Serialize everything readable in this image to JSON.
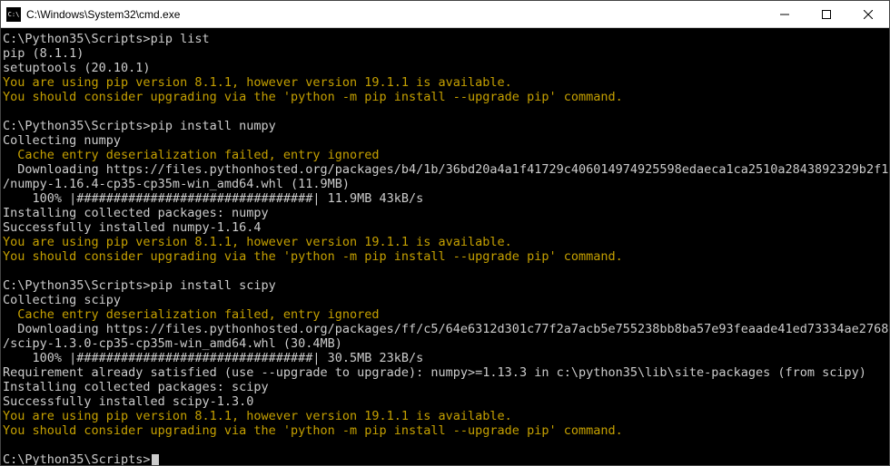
{
  "window": {
    "title": "C:\\Windows\\System32\\cmd.exe"
  },
  "prompt": "C:\\Python35\\Scripts>",
  "cmds": {
    "list": "pip list",
    "install_numpy": "pip install numpy",
    "install_scipy": "pip install scipy"
  },
  "out": {
    "pip_ver": "pip (8.1.1)",
    "setuptools_ver": "setuptools (20.10.1)",
    "warn_ver": "You are using pip version 8.1.1, however version 19.1.1 is available.",
    "warn_upgrade": "You should consider upgrading via the 'python -m pip install --upgrade pip' command.",
    "collecting_numpy": "Collecting numpy",
    "collecting_scipy": "Collecting scipy",
    "cache_fail": "  Cache entry deserialization failed, entry ignored",
    "dl_numpy_url": "  Downloading https://files.pythonhosted.org/packages/b4/1b/36bd20a4a1f41729c406014974925598edaeca1ca2510a2843892329b2f1",
    "dl_numpy_whl": "/numpy-1.16.4-cp35-cp35m-win_amd64.whl (11.9MB)",
    "progress_numpy": "    100% |################################| 11.9MB 43kB/s",
    "installing_numpy": "Installing collected packages: numpy",
    "success_numpy": "Successfully installed numpy-1.16.4",
    "dl_scipy_url": "  Downloading https://files.pythonhosted.org/packages/ff/c5/64e6312d301c77f2a7acb5e755238bb8ba57e93feaade41ed73334ae2768",
    "dl_scipy_whl": "/scipy-1.3.0-cp35-cp35m-win_amd64.whl (30.4MB)",
    "progress_scipy": "    100% |################################| 30.5MB 23kB/s",
    "req_satisfied": "Requirement already satisfied (use --upgrade to upgrade): numpy>=1.13.3 in c:\\python35\\lib\\site-packages (from scipy)",
    "installing_scipy": "Installing collected packages: scipy",
    "success_scipy": "Successfully installed scipy-1.3.0"
  }
}
